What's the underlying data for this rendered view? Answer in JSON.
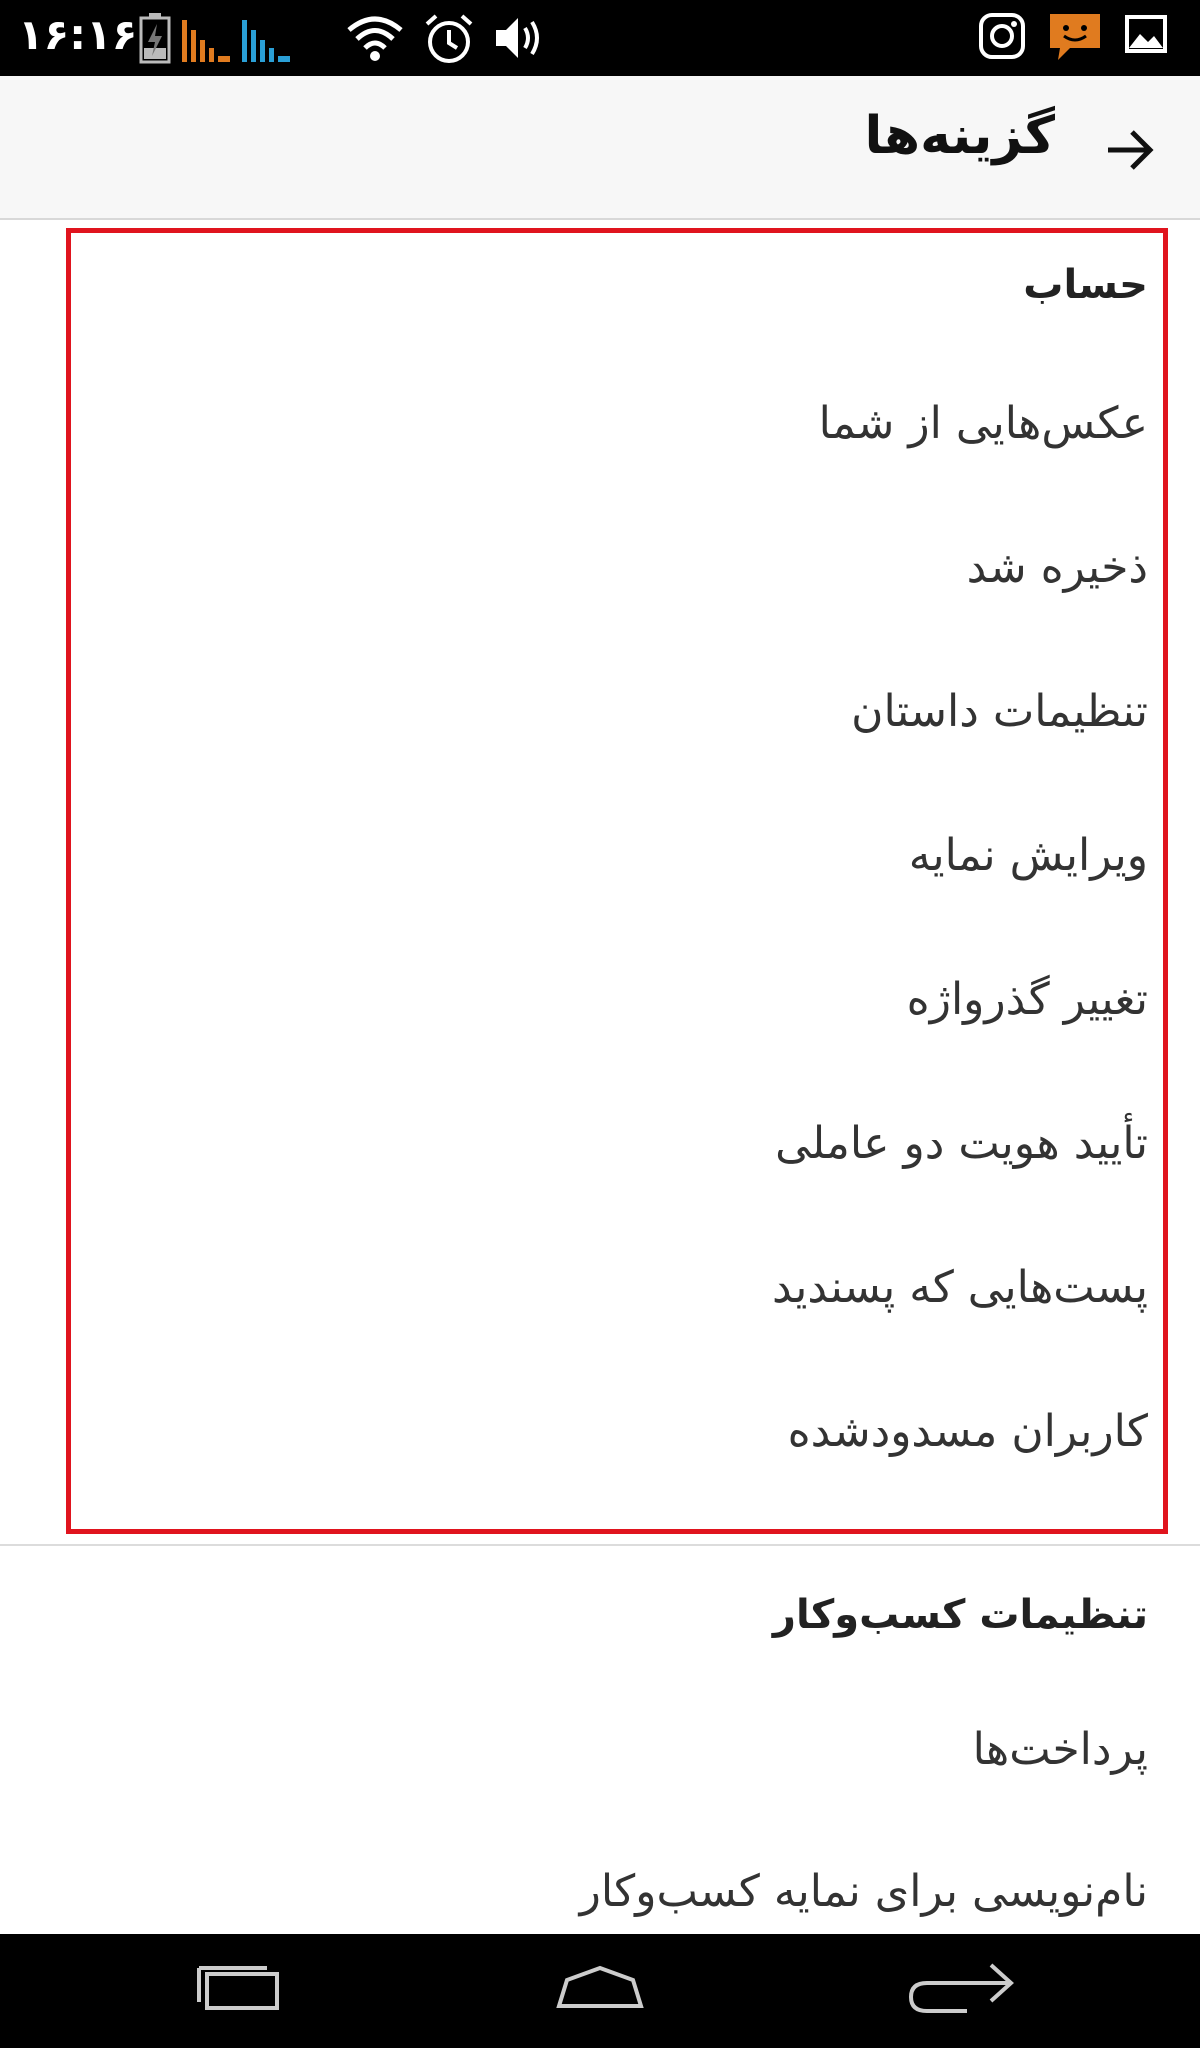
{
  "status_bar": {
    "time": "۱۶:۱۶",
    "icons": [
      "battery-charging-icon",
      "signal-sim1-icon",
      "signal-sim2-icon",
      "wifi-icon",
      "alarm-icon",
      "volume-icon",
      "instagram-icon",
      "chat-notification-icon",
      "image-notification-icon"
    ],
    "colors": {
      "sim1": "#e07b1f",
      "sim2": "#2a9fd6",
      "chat": "#e07b1f"
    }
  },
  "app_bar": {
    "title": "گزینه‌ها",
    "back_icon": "arrow-right-icon"
  },
  "account_section": {
    "header": "حساب",
    "items": [
      {
        "label": "عکس‌هایی از شما"
      },
      {
        "label": "ذخیره شد"
      },
      {
        "label": "تنظیمات داستان"
      },
      {
        "label": "ویرایش نمایه"
      },
      {
        "label": "تغییر گذرواژه"
      },
      {
        "label": "تأیید هویت دو عاملی"
      },
      {
        "label": "پست‌هایی که پسندید"
      },
      {
        "label": "کاربران مسدودشده"
      }
    ]
  },
  "business_section": {
    "header": "تنظیمات کسب‌وکار",
    "items": [
      {
        "label": "پرداخت‌ها"
      },
      {
        "label": "نام‌نویسی برای نمایه کسب‌وکار"
      }
    ]
  },
  "highlight_color": "#e0141e",
  "nav_bar": {
    "icons": [
      "recent-apps-icon",
      "home-icon",
      "back-icon"
    ]
  }
}
